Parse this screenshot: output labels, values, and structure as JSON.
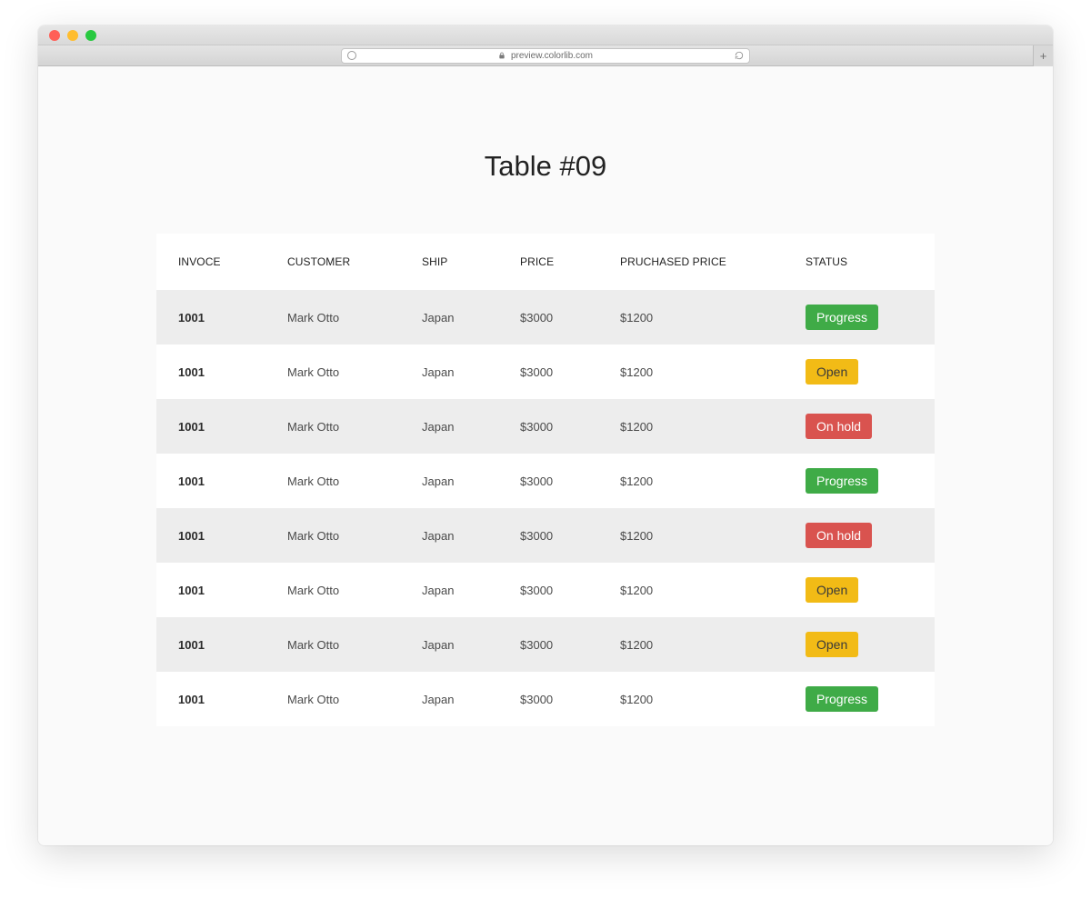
{
  "browser": {
    "url_text": "preview.colorlib.com"
  },
  "page": {
    "title": "Table #09"
  },
  "table": {
    "headers": {
      "invoice": "INVOCE",
      "customer": "CUSTOMER",
      "ship": "SHIP",
      "price": "PRICE",
      "purchased": "PRUCHASED PRICE",
      "status": "STATUS"
    },
    "rows": [
      {
        "invoice": "1001",
        "customer": "Mark Otto",
        "ship": "Japan",
        "price": "$3000",
        "purchased": "$1200",
        "status": "Progress",
        "status_type": "progress"
      },
      {
        "invoice": "1001",
        "customer": "Mark Otto",
        "ship": "Japan",
        "price": "$3000",
        "purchased": "$1200",
        "status": "Open",
        "status_type": "open"
      },
      {
        "invoice": "1001",
        "customer": "Mark Otto",
        "ship": "Japan",
        "price": "$3000",
        "purchased": "$1200",
        "status": "On hold",
        "status_type": "onhold"
      },
      {
        "invoice": "1001",
        "customer": "Mark Otto",
        "ship": "Japan",
        "price": "$3000",
        "purchased": "$1200",
        "status": "Progress",
        "status_type": "progress"
      },
      {
        "invoice": "1001",
        "customer": "Mark Otto",
        "ship": "Japan",
        "price": "$3000",
        "purchased": "$1200",
        "status": "On hold",
        "status_type": "onhold"
      },
      {
        "invoice": "1001",
        "customer": "Mark Otto",
        "ship": "Japan",
        "price": "$3000",
        "purchased": "$1200",
        "status": "Open",
        "status_type": "open"
      },
      {
        "invoice": "1001",
        "customer": "Mark Otto",
        "ship": "Japan",
        "price": "$3000",
        "purchased": "$1200",
        "status": "Open",
        "status_type": "open"
      },
      {
        "invoice": "1001",
        "customer": "Mark Otto",
        "ship": "Japan",
        "price": "$3000",
        "purchased": "$1200",
        "status": "Progress",
        "status_type": "progress"
      }
    ]
  },
  "status_colors": {
    "progress": "#3fab47",
    "open": "#f2bb16",
    "onhold": "#d9534f"
  }
}
